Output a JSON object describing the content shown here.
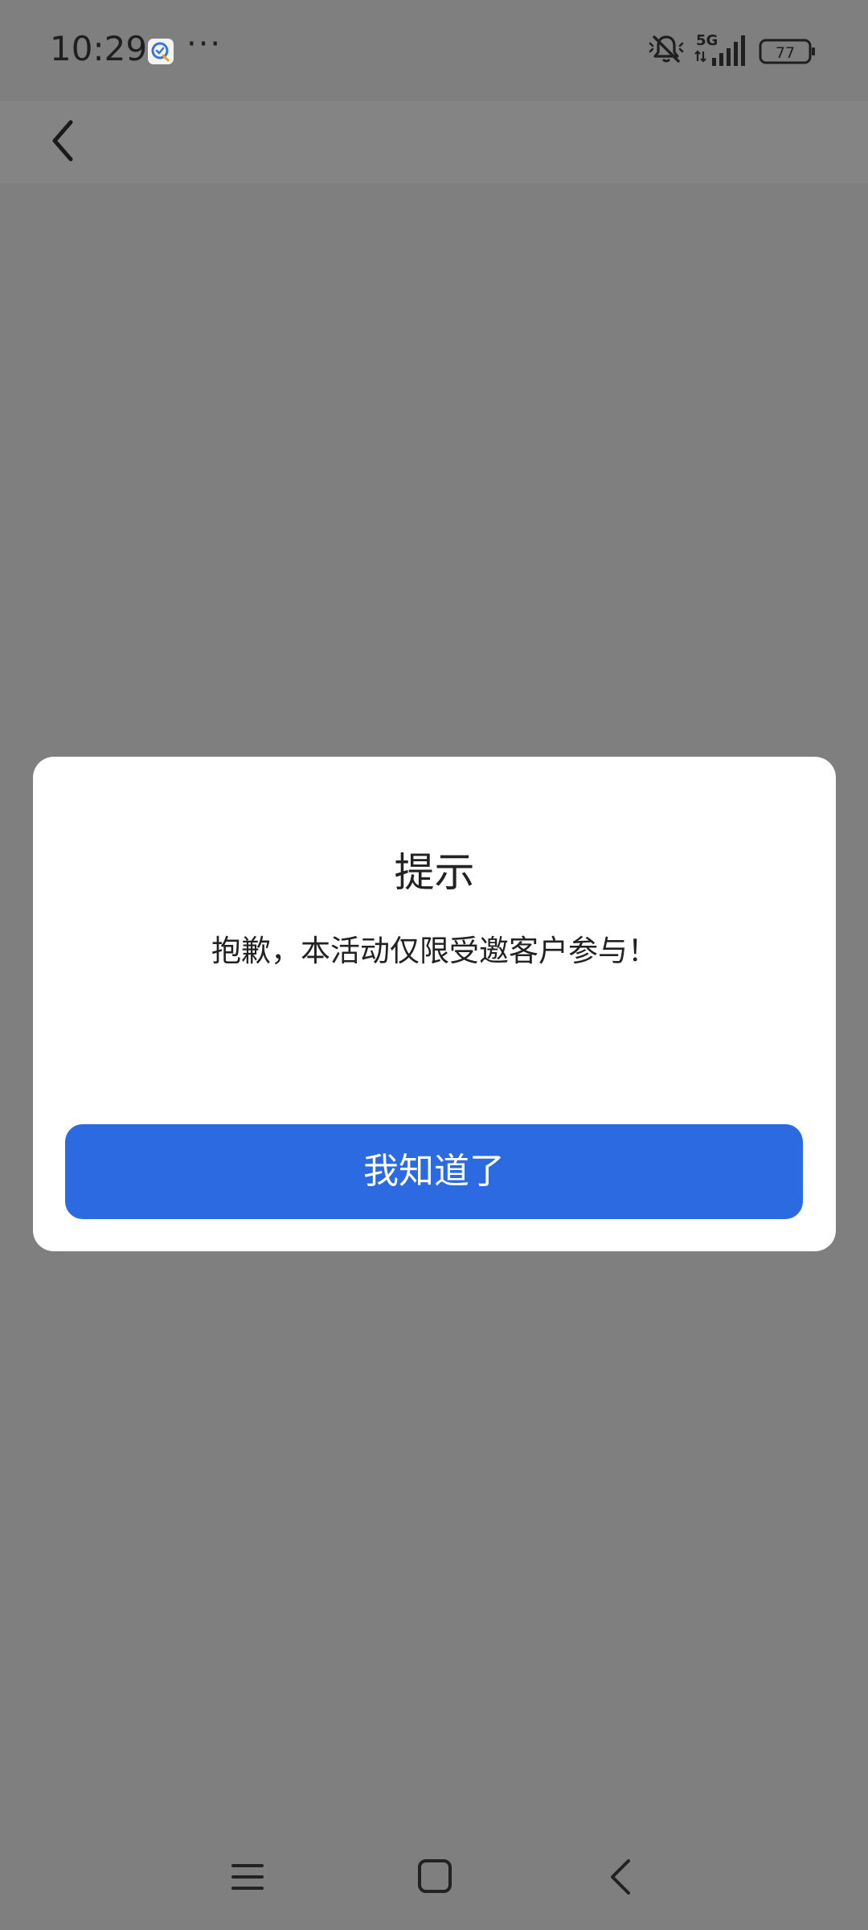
{
  "status_bar": {
    "time": "10:29",
    "more": "···",
    "network": "5G",
    "battery": "77",
    "icons": [
      "app-notification-icon",
      "mute-icon",
      "signal-icon",
      "battery-icon"
    ]
  },
  "header": {
    "back_icon": "chevron-left-icon"
  },
  "dialog": {
    "title": "提示",
    "message": "抱歉，本活动仅限受邀客户参与！",
    "confirm_label": "我知道了"
  },
  "nav_bar": {
    "icons": [
      "menu-icon",
      "home-icon",
      "back-icon"
    ]
  },
  "colors": {
    "overlay": "#7f7f7f",
    "dialog_bg": "#ffffff",
    "primary": "#2c6ae2",
    "text": "#222222"
  }
}
